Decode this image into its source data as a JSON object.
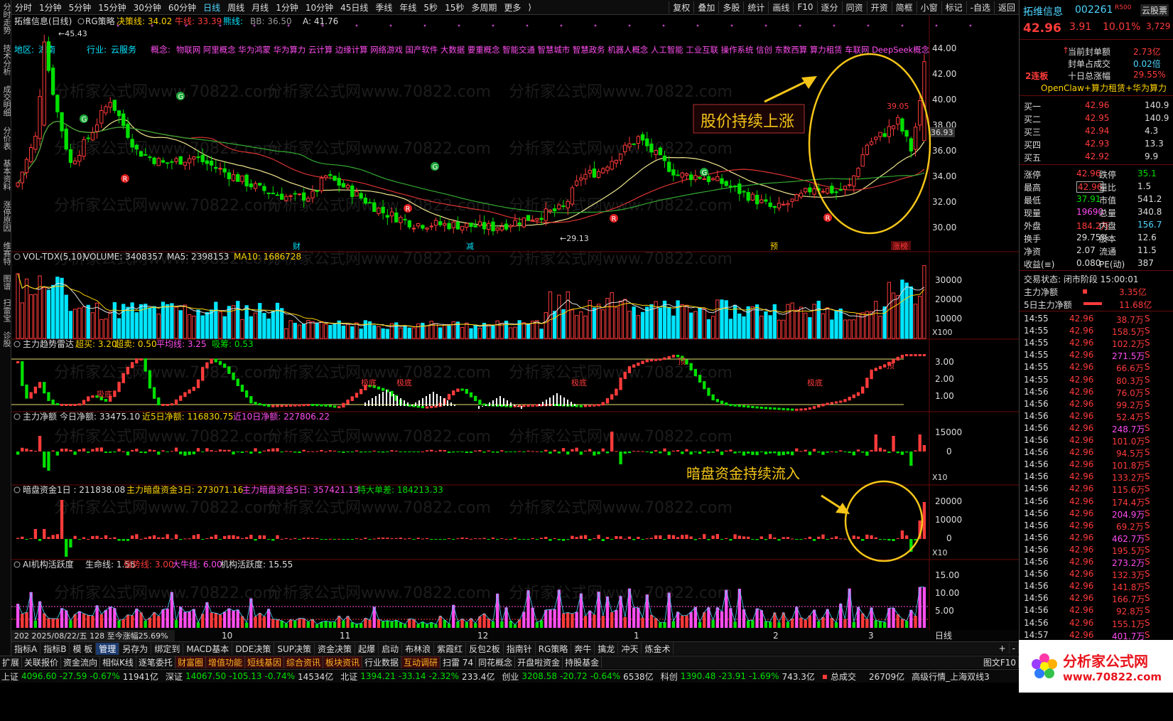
{
  "top_tabs": [
    "分时",
    "1分钟",
    "5分钟",
    "15分钟",
    "30分钟",
    "60分钟",
    "日线",
    "周线",
    "月线",
    "1分钟",
    "10分钟",
    "45日线",
    "季线",
    "年线",
    "5秒",
    "15秒",
    "多周期",
    "更多"
  ],
  "active_period": "日线",
  "top_tools": [
    "复权",
    "叠加",
    "多股",
    "统计",
    "画线",
    "F10",
    "逐分",
    "同资",
    "开资",
    "简框",
    "小窗",
    "标记",
    "-自选",
    "返回"
  ],
  "left_tabs": [
    "分时走势",
    "技术分析",
    "成交明细",
    "分价表",
    "基本资料",
    "涨停原因",
    "维赛特",
    "图谱",
    "扫雷宝",
    "诊股"
  ],
  "chart": {
    "title": "拓维信息(日线)",
    "indicator_name": "RG策略",
    "decision_label": "决策线: 34.02",
    "bull_label": "牛线: 33.39",
    "bear_label": "熊线:",
    "bb_label": "BB: 36.50",
    "a_label": "A: 41.76",
    "high_label": "45.43",
    "low_label": "29.13",
    "last_label": "39.05",
    "price_tag": "36.93",
    "info_region_label": "地区:",
    "info_region": "湖南",
    "info_industry_label": "行业:",
    "info_industry": "云服务",
    "concept_label": "概念:",
    "concepts": "物联网 阿里概念 华为鸿蒙 华为算力 云计算 边缘计算 网络游戏 国产软件 大数据 要重概念 智能交通 智慧城市 智慧政务 机器人概念 人工智能 工业互联 操作系统 信创 东数西算 算力租赁 车联网 DeepSeek概念",
    "y_labels": [
      "44.00",
      "42.00",
      "40.00",
      "38.00",
      "36.00",
      "34.00",
      "32.00",
      "30.00"
    ],
    "annotation1": "股价持续上涨",
    "annotation2": "暗盘资金持续流入",
    "event_labels": [
      "财",
      "减",
      "预",
      "涨榜"
    ],
    "watermark": "分析家公式网www.70822.com"
  },
  "vol": {
    "title": "VOL-TDX(5,10)",
    "volume": "VOLUME: 3408357",
    "ma5": "MA5: 2398153",
    "ma10": "MA10: 1686728",
    "y_labels": [
      "30000",
      "20000",
      "10000"
    ],
    "unit": "X100"
  },
  "radar": {
    "title": "主力趋势雷达",
    "l1": "超买: 3.20",
    "l2": "超卖: 0.50",
    "l3": "平均线: 3.25",
    "l4": "吸筹: 0.53",
    "y_labels": [
      "3.00",
      "2.00",
      "1.00"
    ],
    "tags": [
      "吸底",
      "极底",
      "极底",
      "极底",
      "极底",
      "顶",
      "顶"
    ]
  },
  "netflow": {
    "title": "主力净额",
    "today": "今日净额: 33475.10",
    "d5": "近5日净额: 116830.75",
    "d10": "近10日净额: 227806.22",
    "y_labels": [
      "15000",
      "0"
    ],
    "unit": "X10"
  },
  "darkpool": {
    "title": "暗盘资金1日 : 211838.08",
    "d3": "主力暗盘资金3日: 273071.16",
    "d5": "主力暗盘资金5日: 357421.13",
    "big": "特大单差: 184213.33",
    "y_labels": [
      "20000",
      "10000",
      "0"
    ],
    "unit": "X10"
  },
  "ai": {
    "title": "AI机构活跃度",
    "l1": "生命线: 1.56",
    "l2": "强势线: 3.00",
    "l3": "大牛线: 6.00",
    "l4": "机构活跃度: 15.55",
    "y_labels": [
      "15.00",
      "10.00",
      "5.00"
    ]
  },
  "date_axis": {
    "date_info": "202 2025/08/22/五 128 至今涨幅25.69%",
    "months": [
      "10",
      "11",
      "12",
      "1",
      "2",
      "3"
    ],
    "period_btn": "日线"
  },
  "right": {
    "name": "拓维信息",
    "code": "002261",
    "tag": "R500",
    "cloud": "云股票",
    "price": "42.96",
    "change": "3.91",
    "pct": "10.01%",
    "side": "3,729",
    "limit_label": "2连板",
    "seal_label": "当前封单额",
    "seal": "2.73亿",
    "seal_ratio_label": "封单占成交",
    "seal_ratio": "0.02倍",
    "ten_label": "十日总涨幅",
    "ten": "29.55%",
    "theme": "OpenClaw+算力租赁+华为算力",
    "bids": [
      {
        "l": "买一",
        "p": "42.96",
        "v": "140.9"
      },
      {
        "l": "买二",
        "p": "42.95",
        "v": "140.9"
      },
      {
        "l": "买三",
        "p": "42.94",
        "v": "4.3"
      },
      {
        "l": "买四",
        "p": "42.93",
        "v": "13.3"
      },
      {
        "l": "买五",
        "p": "42.92",
        "v": "9.9"
      }
    ],
    "stats": [
      {
        "a": "涨停",
        "b": "42.96",
        "c": "跌停",
        "d": "35.1"
      },
      {
        "a": "最高",
        "b": "42.96",
        "c": "量比",
        "d": "1.5"
      },
      {
        "a": "最低",
        "b": "37.91",
        "c": "市值",
        "d": "541.2"
      },
      {
        "a": "现量",
        "b": "19690",
        "c": "总量",
        "d": "340.8"
      },
      {
        "a": "外盘",
        "b": "184.2万",
        "c": "内盘",
        "d": "156.7"
      },
      {
        "a": "换手",
        "b": "29.75%",
        "c": "股本",
        "d": "12.6"
      },
      {
        "a": "净资",
        "b": "2.07",
        "c": "流通",
        "d": "11.5"
      },
      {
        "a": "收益(≡)",
        "b": "0.080",
        "c": "PE(动)",
        "d": "387"
      }
    ],
    "trade_status": "交易状态: 闭市阶段 15:00:01",
    "main_net_label": "主力净额",
    "main_net": "3.35亿",
    "main5_label": "5日主力净额",
    "main5": "11.68亿",
    "ticks": [
      {
        "t": "14:55",
        "p": "42.96",
        "v": "38.7万"
      },
      {
        "t": "14:55",
        "p": "42.96",
        "v": "158.5万"
      },
      {
        "t": "14:55",
        "p": "42.96",
        "v": "102.2万"
      },
      {
        "t": "14:55",
        "p": "42.96",
        "v": "271.5万"
      },
      {
        "t": "14:55",
        "p": "42.96",
        "v": "66.6万"
      },
      {
        "t": "14:55",
        "p": "42.96",
        "v": "80.3万"
      },
      {
        "t": "14:56",
        "p": "42.96",
        "v": "76.0万"
      },
      {
        "t": "14:56",
        "p": "42.96",
        "v": "99.2万"
      },
      {
        "t": "14:56",
        "p": "42.96",
        "v": "52.4万"
      },
      {
        "t": "14:56",
        "p": "42.96",
        "v": "248.7万"
      },
      {
        "t": "14:56",
        "p": "42.96",
        "v": "101.0万"
      },
      {
        "t": "14:56",
        "p": "42.96",
        "v": "94.5万"
      },
      {
        "t": "14:56",
        "p": "42.96",
        "v": "101.8万"
      },
      {
        "t": "14:56",
        "p": "42.96",
        "v": "133.2万"
      },
      {
        "t": "14:56",
        "p": "42.96",
        "v": "115.6万"
      },
      {
        "t": "14:56",
        "p": "42.96",
        "v": "174.4万"
      },
      {
        "t": "14:56",
        "p": "42.96",
        "v": "204.9万"
      },
      {
        "t": "14:56",
        "p": "42.96",
        "v": "69.2万"
      },
      {
        "t": "14:56",
        "p": "42.96",
        "v": "462.7万"
      },
      {
        "t": "14:56",
        "p": "42.96",
        "v": "195.5万"
      },
      {
        "t": "14:56",
        "p": "42.96",
        "v": "273.2万"
      },
      {
        "t": "14:56",
        "p": "42.96",
        "v": "132.3万"
      },
      {
        "t": "14:56",
        "p": "42.96",
        "v": "141.8万"
      },
      {
        "t": "14:56",
        "p": "42.96",
        "v": "166.7万"
      },
      {
        "t": "14:56",
        "p": "42.96",
        "v": "92.8万"
      },
      {
        "t": "14:56",
        "p": "42.96",
        "v": "155.1万"
      },
      {
        "t": "14:57",
        "p": "42.96",
        "v": "401.7万"
      }
    ]
  },
  "bottom_tabs": [
    "指标A",
    "指标B",
    "模 板",
    "管理",
    "另存为",
    "绑定到",
    "MACD基本",
    "DDE决策",
    "SUP决策",
    "资金决策",
    "起爆",
    "启动",
    "布林浪",
    "紫霞红",
    "反包2板",
    "指南针",
    "RG策略",
    "奔牛",
    "擒龙",
    "冲天",
    "炼金术"
  ],
  "bottom_tabs_active": "管理",
  "bottom_right": [
    "+",
    "-"
  ],
  "func_tabs": [
    "扩展",
    "关联报价",
    "资金流向",
    "相似K线",
    "逐笔委托",
    "财富圈",
    "增值功能",
    "短线基因",
    "综合资讯",
    "板块资讯",
    "行业数据",
    "互动调研",
    "扫雷 74",
    "同花概念",
    "开盘啦资金",
    "持股基金"
  ],
  "func_right": "图文F10",
  "status": [
    {
      "n": "上证",
      "v": "4096.60",
      "c": "-27.59",
      "p": "-0.67%",
      "a": "11941亿"
    },
    {
      "n": "深证",
      "v": "14067.50",
      "c": "-105.13",
      "p": "-0.74%",
      "a": "14534亿"
    },
    {
      "n": "北证",
      "v": "1394.21",
      "c": "-33.14",
      "p": "-2.32%",
      "a": "233.4亿"
    },
    {
      "n": "创业",
      "v": "3208.58",
      "c": "-20.72",
      "p": "-0.64%",
      "a": "6538亿"
    },
    {
      "n": "科创",
      "v": "1390.48",
      "c": "-23.91",
      "p": "-1.69%",
      "a": "743.3亿"
    }
  ],
  "status_total_label": "总成交",
  "status_total": "26709亿",
  "status_tail": "高级行情_上海双线3",
  "logo": {
    "text": "分析家公式网",
    "url": "www.70822.com"
  },
  "colors": {
    "up": "#ff3b3b",
    "down": "#00e000",
    "accent": "#4fd6ff",
    "annotation": "#f5c518",
    "vol_down": "#00e5ff"
  }
}
